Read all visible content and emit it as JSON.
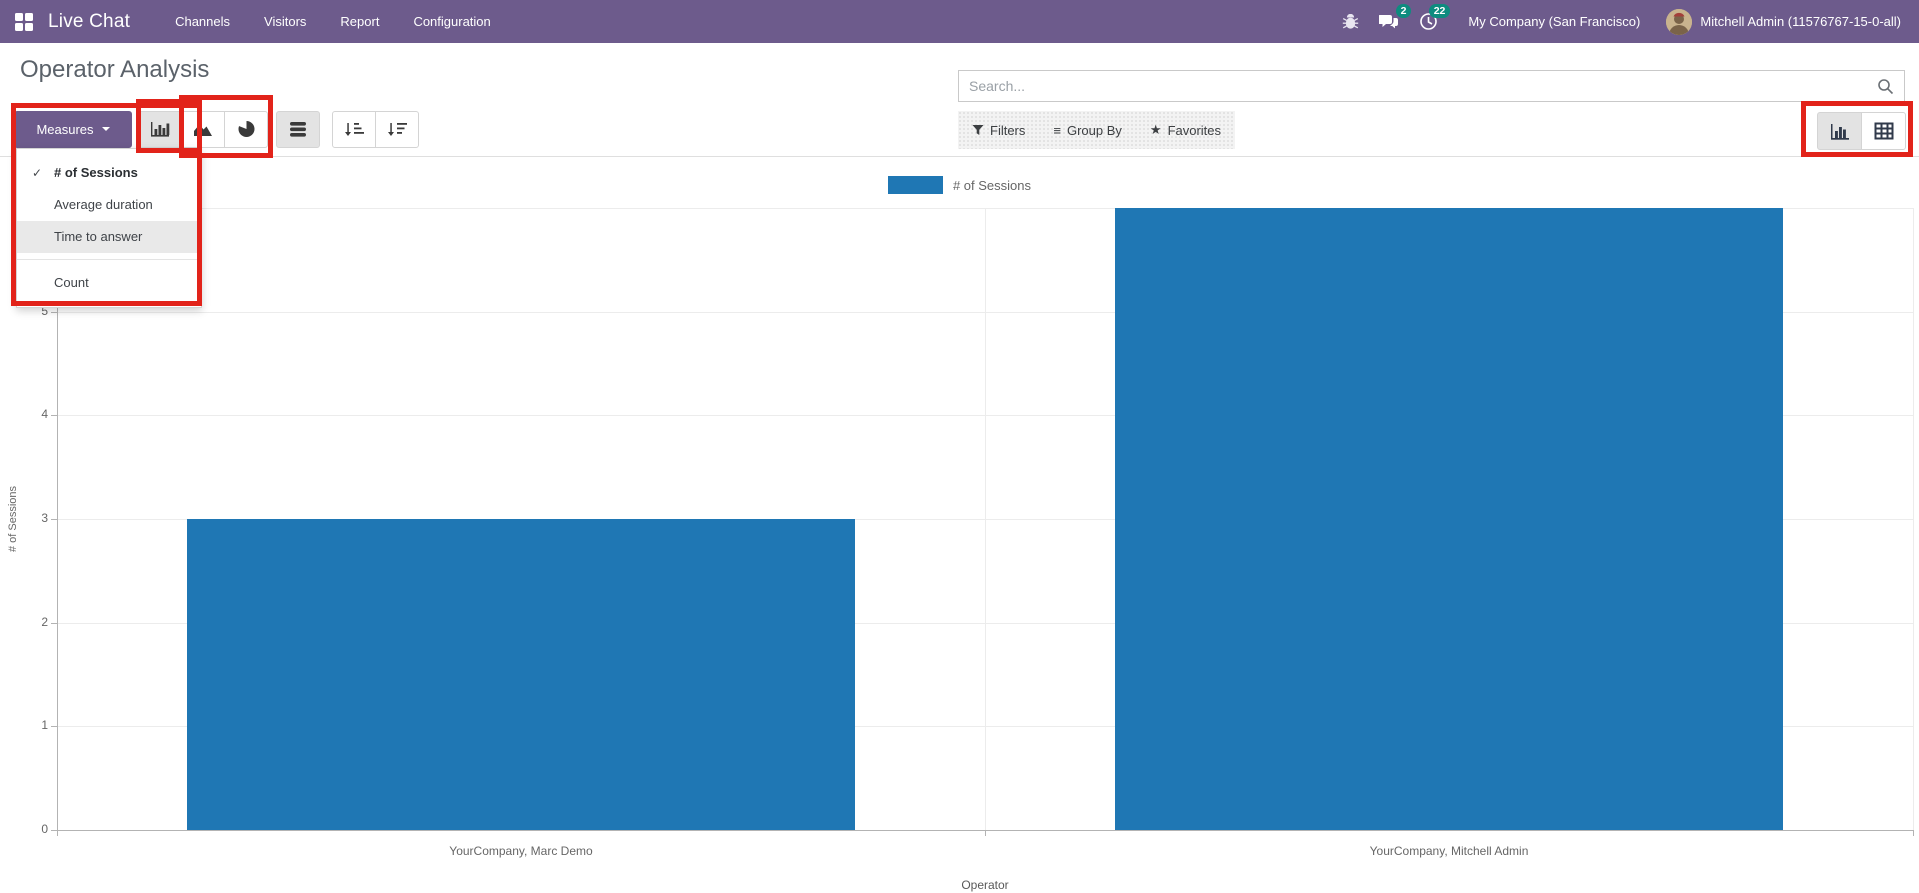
{
  "navbar": {
    "brand": "Live Chat",
    "menus": [
      "Channels",
      "Visitors",
      "Report",
      "Configuration"
    ],
    "systray": {
      "messages_badge": "2",
      "activities_badge": "22",
      "company": "My Company (San Francisco)",
      "user": "Mitchell Admin (11576767-15-0-all)"
    },
    "colors": {
      "bg": "#6d5b8c",
      "badge": "#0e8c7f"
    }
  },
  "control_panel": {
    "title": "Operator Analysis",
    "measures_label": "Measures",
    "search_placeholder": "Search...",
    "filters_label": "Filters",
    "groupby_label": "Group By",
    "favorites_label": "Favorites"
  },
  "icons": {
    "check": "✓",
    "group_by_glyph": "≡",
    "favorites_glyph": "★"
  },
  "measures_menu": {
    "items": [
      {
        "label": "# of Sessions",
        "checked": true,
        "hovered": false,
        "separated": false
      },
      {
        "label": "Average duration",
        "checked": false,
        "hovered": false,
        "separated": false
      },
      {
        "label": "Time to answer",
        "checked": false,
        "hovered": true,
        "separated": false
      },
      {
        "label": "Count",
        "checked": false,
        "hovered": false,
        "separated": true
      }
    ]
  },
  "chart_data": {
    "type": "bar",
    "categories": [
      "YourCompany, Marc Demo",
      "YourCompany, Mitchell Admin"
    ],
    "series": [
      {
        "name": "# of Sessions",
        "values": [
          3,
          6
        ]
      }
    ],
    "title": "",
    "xlabel": "Operator",
    "ylabel": "# of Sessions",
    "ylim": [
      0,
      6
    ],
    "yticks": [
      0,
      1,
      2,
      3,
      4,
      5,
      6
    ],
    "legend": "# of Sessions",
    "legend_position": "top",
    "grid": true,
    "bar_color": "#1f77b4"
  }
}
